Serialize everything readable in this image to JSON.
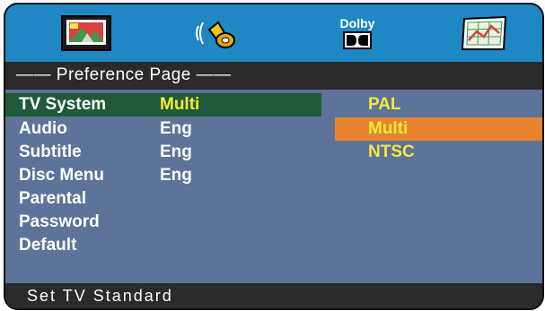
{
  "tabs": [
    {
      "name": "General Setup",
      "icon": "tv-screen-icon"
    },
    {
      "name": "Audio Setup",
      "icon": "speaker-icon"
    },
    {
      "name": "Dolby Setup",
      "icon": "dolby-icon",
      "label": "Dolby"
    },
    {
      "name": "Preference Setup",
      "icon": "preference-chart-icon"
    }
  ],
  "page_title": "—— Preference Page ——",
  "menu": [
    {
      "label": "TV System",
      "value": "Multi",
      "selected": true
    },
    {
      "label": "Audio",
      "value": "Eng"
    },
    {
      "label": "Subtitle",
      "value": "Eng"
    },
    {
      "label": "Disc Menu",
      "value": "Eng"
    },
    {
      "label": "Parental",
      "value": ""
    },
    {
      "label": "Password",
      "value": ""
    },
    {
      "label": "Default",
      "value": ""
    }
  ],
  "options": [
    {
      "label": "PAL"
    },
    {
      "label": "Multi",
      "selected": true
    },
    {
      "label": "NTSC"
    }
  ],
  "status": "Set TV Standard",
  "colors": {
    "tab_bar": "#1e87c4",
    "body": "#5d7399",
    "dark_bar": "#2a2a2a",
    "selected_row": "#1f5a39",
    "selected_option": "#e8842e",
    "active_text": "#f2ea3a"
  }
}
